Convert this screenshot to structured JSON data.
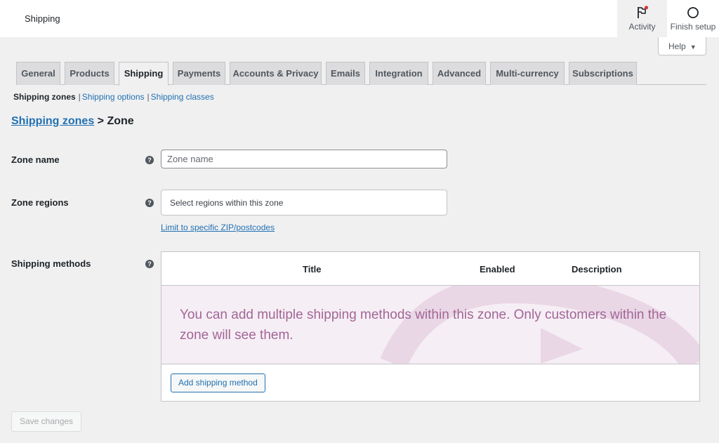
{
  "topbar": {
    "title": "Shipping",
    "activity_label": "Activity",
    "finish_setup_label": "Finish setup",
    "activity_icon": "flag-icon",
    "finish_icon": "circle-progress-icon",
    "notification_color": "#d63638"
  },
  "help": {
    "label": "Help",
    "caret": "▼"
  },
  "tabs": [
    {
      "label": "General"
    },
    {
      "label": "Products"
    },
    {
      "label": "Shipping",
      "active": true
    },
    {
      "label": "Payments"
    },
    {
      "label": "Accounts & Privacy"
    },
    {
      "label": "Emails"
    },
    {
      "label": "Integration"
    },
    {
      "label": "Advanced"
    },
    {
      "label": "Multi-currency"
    },
    {
      "label": "Subscriptions"
    }
  ],
  "subnav": {
    "current": "Shipping zones",
    "separator": "|",
    "links": [
      "Shipping options",
      "Shipping classes"
    ]
  },
  "breadcrumb": {
    "link": "Shipping zones",
    "separator": ">",
    "current": "Zone"
  },
  "form": {
    "zone_name": {
      "label": "Zone name",
      "placeholder": "Zone name",
      "value": ""
    },
    "zone_regions": {
      "label": "Zone regions",
      "placeholder": "Select regions within this zone",
      "limit_link": "Limit to specific ZIP/postcodes"
    },
    "shipping_methods": {
      "label": "Shipping methods",
      "columns": [
        "Title",
        "Enabled",
        "Description"
      ],
      "blank_state": "You can add multiple shipping methods within this zone. Only customers within the zone will see them.",
      "add_button": "Add shipping method"
    },
    "help_glyph": "?"
  },
  "save_button": "Save changes",
  "colors": {
    "accent": "#2271b1",
    "woo_purple": "#a16696",
    "blank_bg": "#f6eef5"
  }
}
